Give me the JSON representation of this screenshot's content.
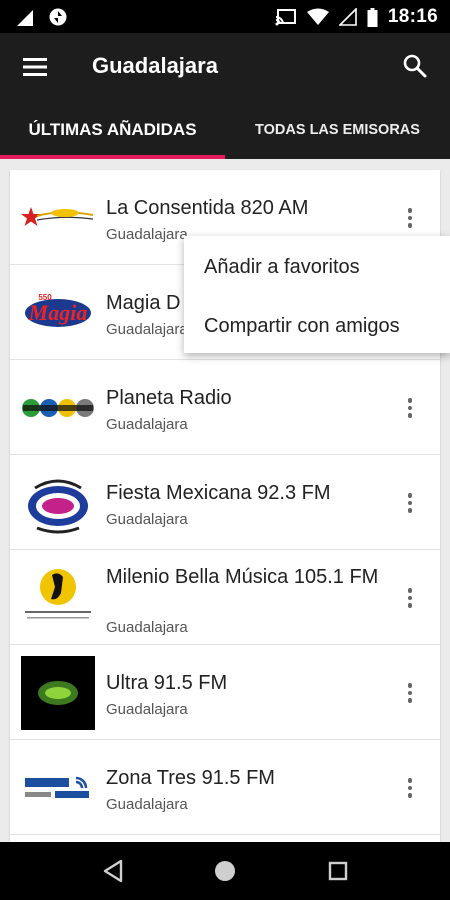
{
  "status_bar": {
    "time": "18:16",
    "icons": [
      "signal-icon",
      "sync-icon",
      "cast-icon",
      "wifi-icon",
      "no-signal-icon",
      "battery-icon"
    ]
  },
  "app_bar": {
    "title": "Guadalajara",
    "icons": [
      "menu-icon",
      "search-icon"
    ]
  },
  "tabs": [
    {
      "label": "ÚLTIMAS AÑADIDAS",
      "selected": true
    },
    {
      "label": "TODAS LAS EMISORAS",
      "selected": false
    }
  ],
  "accent_color": "#e6195c",
  "stations": [
    {
      "name": "La Consentida 820 AM",
      "city": "Guadalajara",
      "logo": "la-consentida-logo"
    },
    {
      "name": "Magia D",
      "city": "Guadalajara",
      "logo": "magia-digital-logo"
    },
    {
      "name": "Planeta Radio",
      "city": "Guadalajara",
      "logo": "planeta-logo"
    },
    {
      "name": "Fiesta Mexicana 92.3 FM",
      "city": "Guadalajara",
      "logo": "fiesta-mexicana-logo"
    },
    {
      "name": "Milenio Bella Música 105.1 FM",
      "city": "Guadalajara",
      "logo": "milenio-logo"
    },
    {
      "name": "Ultra 91.5 FM",
      "city": "Guadalajara",
      "logo": "ultra-logo"
    },
    {
      "name": "Zona Tres 91.5 FM",
      "city": "Guadalajara",
      "logo": "zona-tres-logo"
    }
  ],
  "context_menu": {
    "items": [
      "Añadir a favoritos",
      "Compartir con amigos"
    ]
  },
  "nav_bar": {
    "icons": [
      "back-icon",
      "home-icon",
      "recents-icon"
    ]
  }
}
